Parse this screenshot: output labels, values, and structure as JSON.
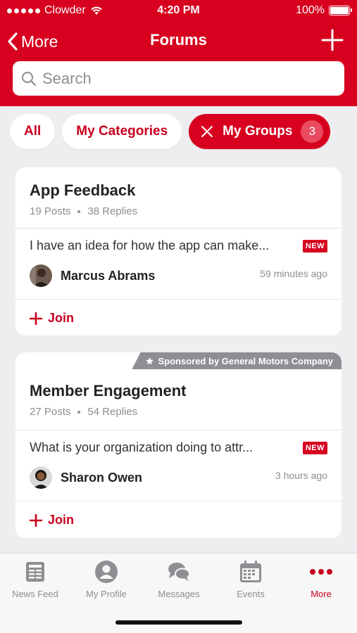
{
  "status_bar": {
    "carrier": "Clowder",
    "time": "4:20 PM",
    "battery": "100%"
  },
  "nav": {
    "back_label": "More",
    "title": "Forums"
  },
  "search": {
    "placeholder": "Search",
    "value": ""
  },
  "filters": [
    {
      "label": "All"
    },
    {
      "label": "My Categories"
    },
    {
      "label": "My Groups",
      "count": "3",
      "active": true
    }
  ],
  "forums": [
    {
      "title": "App Feedback",
      "posts": "19 Posts",
      "replies": "38 Replies",
      "latest_post": "I have an idea for how the app can make...",
      "new_label": "NEW",
      "author": "Marcus Abrams",
      "time": "59 minutes ago",
      "join_label": "Join"
    },
    {
      "sponsor": "Sponsored by General Motors Company",
      "title": "Member Engagement",
      "posts": "27 Posts",
      "replies": "54 Replies",
      "latest_post": "What is your organization doing to attr...",
      "new_label": "NEW",
      "author": "Sharon Owen",
      "time": "3 hours ago",
      "join_label": "Join"
    }
  ],
  "tabs": [
    {
      "label": "News Feed",
      "icon": "news-feed-icon"
    },
    {
      "label": "My Profile",
      "icon": "profile-icon"
    },
    {
      "label": "Messages",
      "icon": "messages-icon"
    },
    {
      "label": "Events",
      "icon": "calendar-icon"
    },
    {
      "label": "More",
      "icon": "more-dots-icon",
      "active": true
    }
  ],
  "colors": {
    "brand": "#d7001f",
    "inactive": "#8e8e93",
    "background": "#eeeef1"
  }
}
